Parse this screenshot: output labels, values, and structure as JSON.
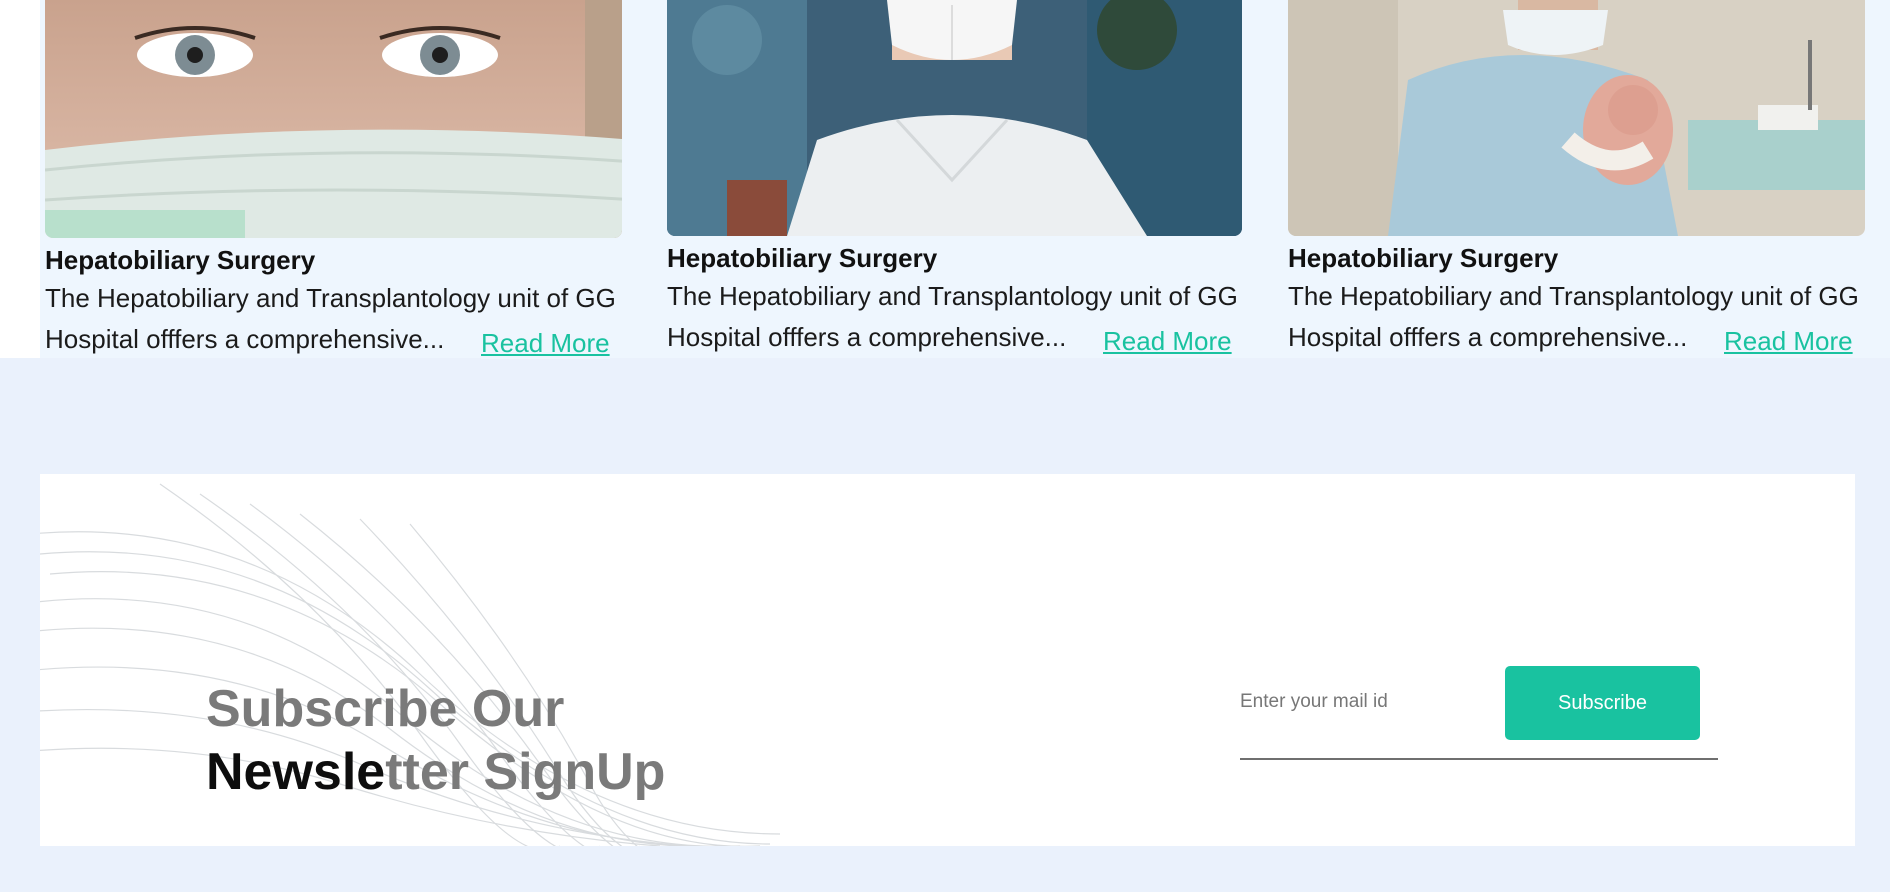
{
  "cards": [
    {
      "title": "Hepatobiliary Surgery",
      "description": "The Hepatobiliary and Transplantology unit of GG Hospital offfers a comprehensive...",
      "read_more": "Read More",
      "image": "doctor-with-mask-eyes-photo"
    },
    {
      "title": "Hepatobiliary Surgery",
      "description": "The Hepatobiliary and Transplantology unit of GG Hospital offfers a comprehensive...",
      "read_more": "Read More",
      "image": "man-in-n95-mask-photo"
    },
    {
      "title": "Hepatobiliary Surgery",
      "description": "The Hepatobiliary and Transplantology unit of GG Hospital offfers a comprehensive...",
      "read_more": "Read More",
      "image": "doctor-holding-newborn-photo"
    }
  ],
  "newsletter": {
    "title_line1": "Subscribe Our",
    "title_line2_dark": "Newsle",
    "title_line2_light": "tter SignUp",
    "email_placeholder": "Enter your mail id",
    "subscribe_label": "Subscribe"
  },
  "colors": {
    "accent": "#19c2a0",
    "page_background": "#eaf1fc",
    "cards_background": "#eef6fe"
  }
}
